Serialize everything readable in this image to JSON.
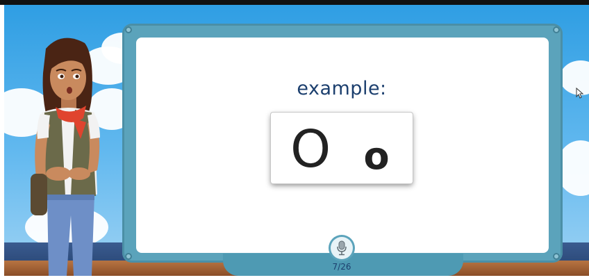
{
  "lesson": {
    "label": "example:",
    "letter_upper": "O",
    "letter_lower": "o"
  },
  "progress": {
    "counter": "7/26",
    "current": 7,
    "total": 26
  },
  "icons": {
    "mic": "microphone-icon",
    "cursor": "mouse-cursor-icon"
  },
  "colors": {
    "sky": "#3fa6e6",
    "board_frame": "#5ba3bb",
    "board": "#ffffff",
    "label_text": "#1c3f6e",
    "letter_text": "#222222"
  }
}
